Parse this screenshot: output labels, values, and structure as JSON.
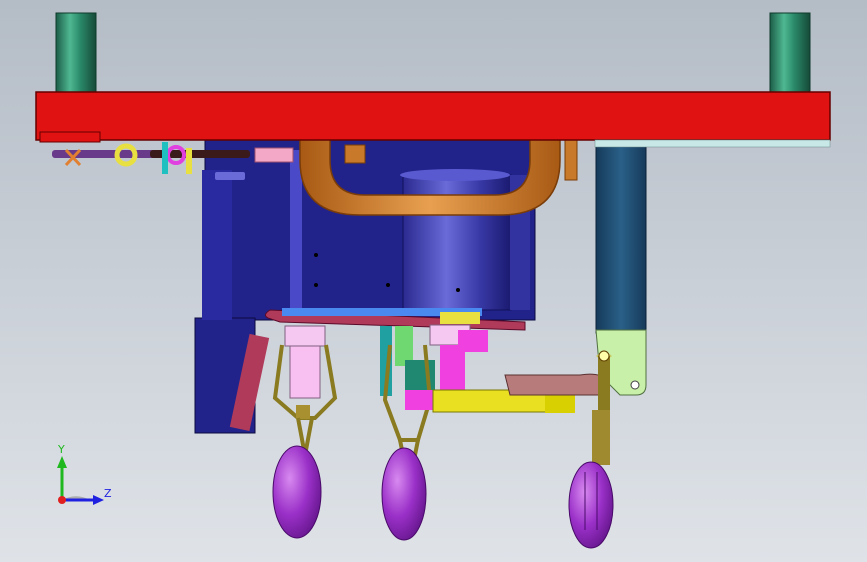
{
  "view": {
    "background_top": "#b4bcc6",
    "background_bottom": "#dfe3e8"
  },
  "triad": {
    "y_label": "Y",
    "z_label": "Z",
    "y_color": "#1fb81f",
    "z_color": "#2020e0",
    "x_color": "#e02020"
  },
  "colors": {
    "plate": "#e01212",
    "pillar": "#2a8a6a",
    "body": "#22238a",
    "handle_loop": "#c87a2a",
    "arm_yellow": "#e8e020",
    "knob": "#8a2ac0",
    "right_post": "#1e4f78",
    "pink": "#f060d0",
    "bracket": "#b87b7b",
    "linkage": "#8a7a20"
  }
}
